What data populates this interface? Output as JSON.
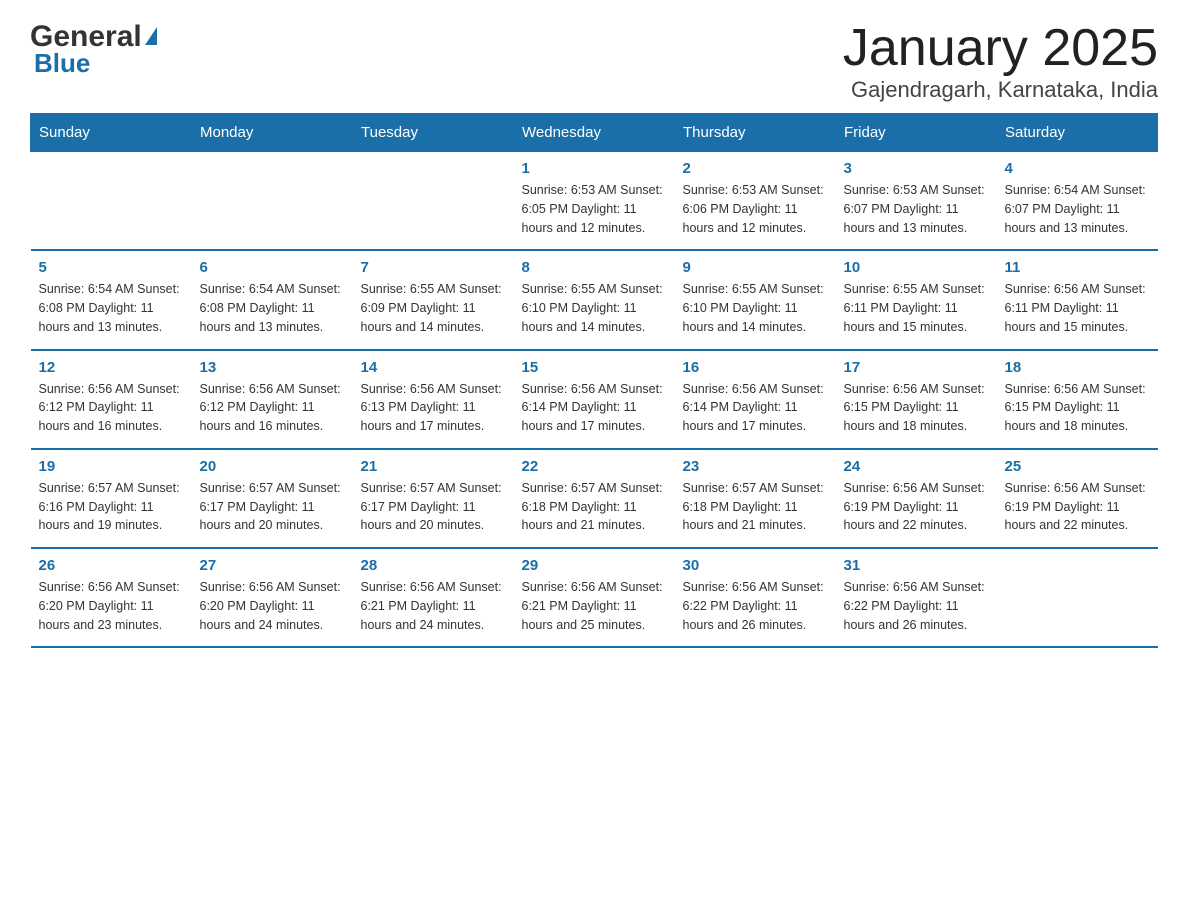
{
  "logo": {
    "general": "General",
    "blue": "Blue"
  },
  "title": "January 2025",
  "subtitle": "Gajendragarh, Karnataka, India",
  "days_header": [
    "Sunday",
    "Monday",
    "Tuesday",
    "Wednesday",
    "Thursday",
    "Friday",
    "Saturday"
  ],
  "weeks": [
    [
      {
        "day": "",
        "info": ""
      },
      {
        "day": "",
        "info": ""
      },
      {
        "day": "",
        "info": ""
      },
      {
        "day": "1",
        "info": "Sunrise: 6:53 AM\nSunset: 6:05 PM\nDaylight: 11 hours\nand 12 minutes."
      },
      {
        "day": "2",
        "info": "Sunrise: 6:53 AM\nSunset: 6:06 PM\nDaylight: 11 hours\nand 12 minutes."
      },
      {
        "day": "3",
        "info": "Sunrise: 6:53 AM\nSunset: 6:07 PM\nDaylight: 11 hours\nand 13 minutes."
      },
      {
        "day": "4",
        "info": "Sunrise: 6:54 AM\nSunset: 6:07 PM\nDaylight: 11 hours\nand 13 minutes."
      }
    ],
    [
      {
        "day": "5",
        "info": "Sunrise: 6:54 AM\nSunset: 6:08 PM\nDaylight: 11 hours\nand 13 minutes."
      },
      {
        "day": "6",
        "info": "Sunrise: 6:54 AM\nSunset: 6:08 PM\nDaylight: 11 hours\nand 13 minutes."
      },
      {
        "day": "7",
        "info": "Sunrise: 6:55 AM\nSunset: 6:09 PM\nDaylight: 11 hours\nand 14 minutes."
      },
      {
        "day": "8",
        "info": "Sunrise: 6:55 AM\nSunset: 6:10 PM\nDaylight: 11 hours\nand 14 minutes."
      },
      {
        "day": "9",
        "info": "Sunrise: 6:55 AM\nSunset: 6:10 PM\nDaylight: 11 hours\nand 14 minutes."
      },
      {
        "day": "10",
        "info": "Sunrise: 6:55 AM\nSunset: 6:11 PM\nDaylight: 11 hours\nand 15 minutes."
      },
      {
        "day": "11",
        "info": "Sunrise: 6:56 AM\nSunset: 6:11 PM\nDaylight: 11 hours\nand 15 minutes."
      }
    ],
    [
      {
        "day": "12",
        "info": "Sunrise: 6:56 AM\nSunset: 6:12 PM\nDaylight: 11 hours\nand 16 minutes."
      },
      {
        "day": "13",
        "info": "Sunrise: 6:56 AM\nSunset: 6:12 PM\nDaylight: 11 hours\nand 16 minutes."
      },
      {
        "day": "14",
        "info": "Sunrise: 6:56 AM\nSunset: 6:13 PM\nDaylight: 11 hours\nand 17 minutes."
      },
      {
        "day": "15",
        "info": "Sunrise: 6:56 AM\nSunset: 6:14 PM\nDaylight: 11 hours\nand 17 minutes."
      },
      {
        "day": "16",
        "info": "Sunrise: 6:56 AM\nSunset: 6:14 PM\nDaylight: 11 hours\nand 17 minutes."
      },
      {
        "day": "17",
        "info": "Sunrise: 6:56 AM\nSunset: 6:15 PM\nDaylight: 11 hours\nand 18 minutes."
      },
      {
        "day": "18",
        "info": "Sunrise: 6:56 AM\nSunset: 6:15 PM\nDaylight: 11 hours\nand 18 minutes."
      }
    ],
    [
      {
        "day": "19",
        "info": "Sunrise: 6:57 AM\nSunset: 6:16 PM\nDaylight: 11 hours\nand 19 minutes."
      },
      {
        "day": "20",
        "info": "Sunrise: 6:57 AM\nSunset: 6:17 PM\nDaylight: 11 hours\nand 20 minutes."
      },
      {
        "day": "21",
        "info": "Sunrise: 6:57 AM\nSunset: 6:17 PM\nDaylight: 11 hours\nand 20 minutes."
      },
      {
        "day": "22",
        "info": "Sunrise: 6:57 AM\nSunset: 6:18 PM\nDaylight: 11 hours\nand 21 minutes."
      },
      {
        "day": "23",
        "info": "Sunrise: 6:57 AM\nSunset: 6:18 PM\nDaylight: 11 hours\nand 21 minutes."
      },
      {
        "day": "24",
        "info": "Sunrise: 6:56 AM\nSunset: 6:19 PM\nDaylight: 11 hours\nand 22 minutes."
      },
      {
        "day": "25",
        "info": "Sunrise: 6:56 AM\nSunset: 6:19 PM\nDaylight: 11 hours\nand 22 minutes."
      }
    ],
    [
      {
        "day": "26",
        "info": "Sunrise: 6:56 AM\nSunset: 6:20 PM\nDaylight: 11 hours\nand 23 minutes."
      },
      {
        "day": "27",
        "info": "Sunrise: 6:56 AM\nSunset: 6:20 PM\nDaylight: 11 hours\nand 24 minutes."
      },
      {
        "day": "28",
        "info": "Sunrise: 6:56 AM\nSunset: 6:21 PM\nDaylight: 11 hours\nand 24 minutes."
      },
      {
        "day": "29",
        "info": "Sunrise: 6:56 AM\nSunset: 6:21 PM\nDaylight: 11 hours\nand 25 minutes."
      },
      {
        "day": "30",
        "info": "Sunrise: 6:56 AM\nSunset: 6:22 PM\nDaylight: 11 hours\nand 26 minutes."
      },
      {
        "day": "31",
        "info": "Sunrise: 6:56 AM\nSunset: 6:22 PM\nDaylight: 11 hours\nand 26 minutes."
      },
      {
        "day": "",
        "info": ""
      }
    ]
  ]
}
